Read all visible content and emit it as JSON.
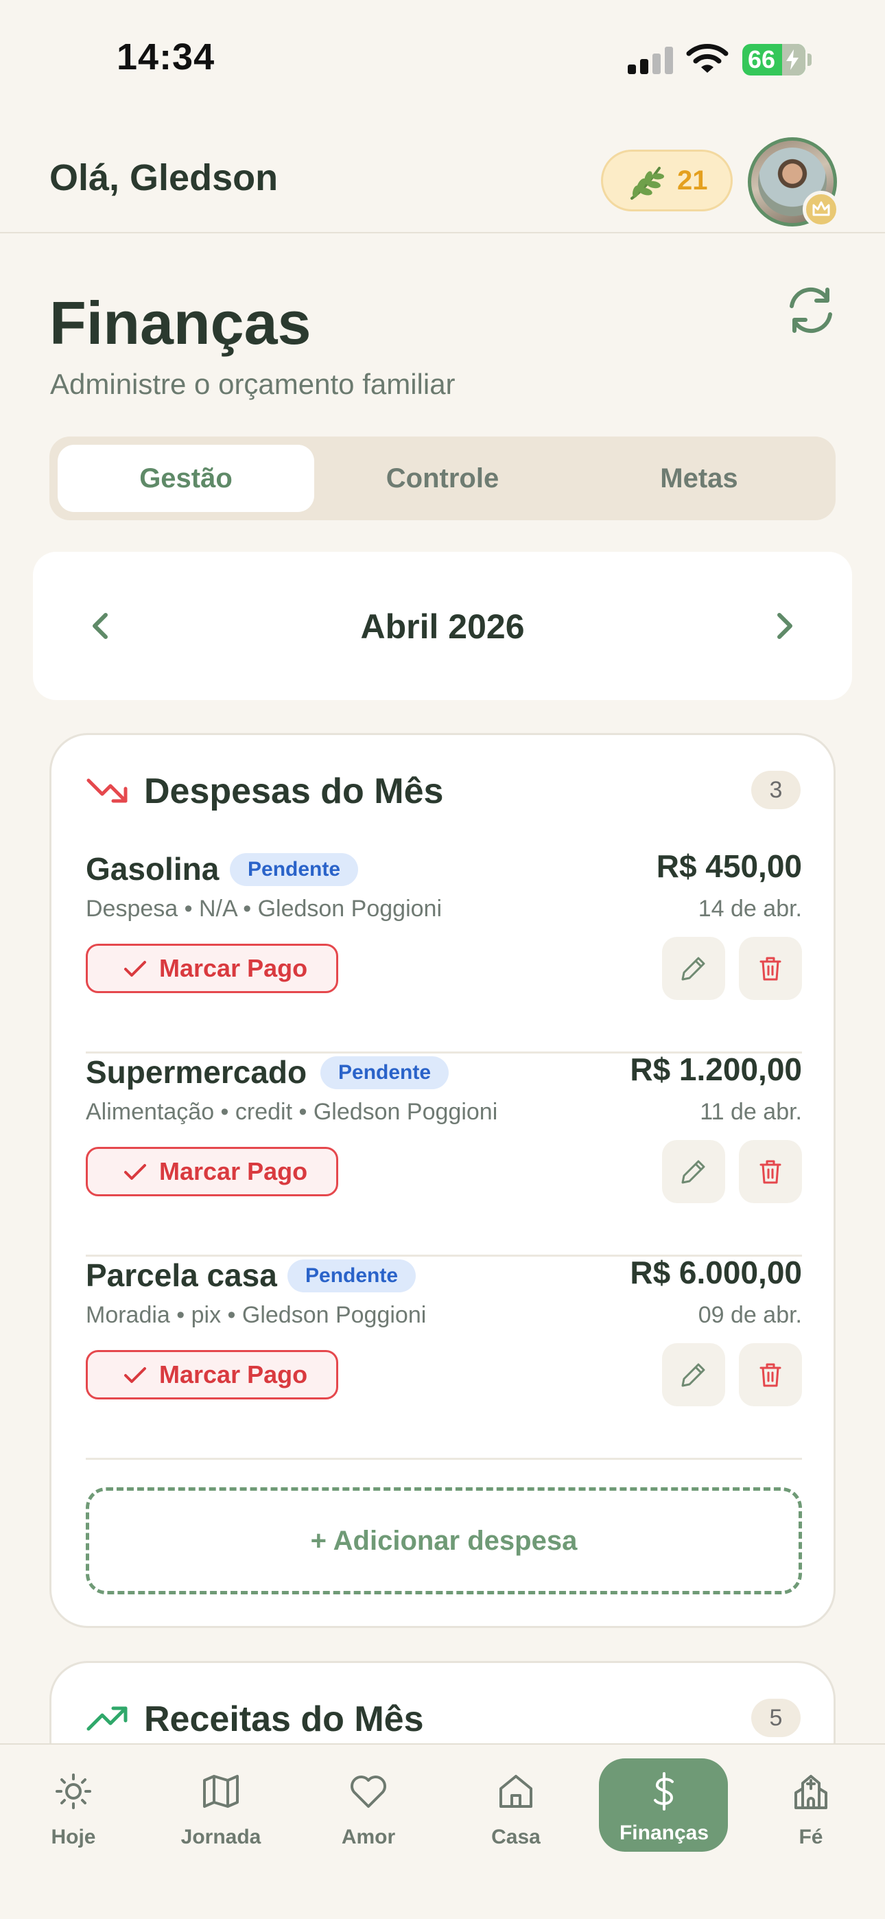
{
  "status_bar": {
    "time": "14:34",
    "battery": "66"
  },
  "header": {
    "greeting": "Olá, Gledson",
    "streak_count": "21",
    "streak_icon": "sprout-icon"
  },
  "page": {
    "title": "Finanças",
    "subtitle": "Administre o orçamento familiar"
  },
  "tabs": [
    {
      "label": "Gestão",
      "active": true
    },
    {
      "label": "Controle",
      "active": false
    },
    {
      "label": "Metas",
      "active": false
    }
  ],
  "month_nav": {
    "label": "Abril 2026"
  },
  "expenses": {
    "title": "Despesas do Mês",
    "count": "3",
    "items": [
      {
        "name": "Gasolina",
        "status": "Pendente",
        "meta": "Despesa • N/A • Gledson Poggioni",
        "amount": "R$ 450,00",
        "date": "14 de abr.",
        "pay_label": "Marcar Pago"
      },
      {
        "name": "Supermercado",
        "status": "Pendente",
        "meta": "Alimentação • credit • Gledson Poggioni",
        "amount": "R$ 1.200,00",
        "date": "11 de abr.",
        "pay_label": "Marcar Pago"
      },
      {
        "name": "Parcela casa",
        "status": "Pendente",
        "meta": "Moradia • pix • Gledson Poggioni",
        "amount": "R$ 6.000,00",
        "date": "09 de abr.",
        "pay_label": "Marcar Pago"
      }
    ],
    "add_label": "+ Adicionar despesa"
  },
  "income": {
    "title": "Receitas do Mês",
    "count": "5"
  },
  "bottom_nav": [
    {
      "label": "Hoje",
      "icon": "sun-icon"
    },
    {
      "label": "Jornada",
      "icon": "map-icon"
    },
    {
      "label": "Amor",
      "icon": "heart-icon"
    },
    {
      "label": "Casa",
      "icon": "home-icon"
    },
    {
      "label": "Finanças",
      "icon": "dollar-icon",
      "active": true
    },
    {
      "label": "Fé",
      "icon": "church-icon"
    }
  ],
  "colors": {
    "background": "#f8f5ef",
    "accent_green": "#6f9a76",
    "danger_red": "#e5484d",
    "pending_blue": "#2a63c9",
    "streak_gold": "#e4a01f"
  }
}
